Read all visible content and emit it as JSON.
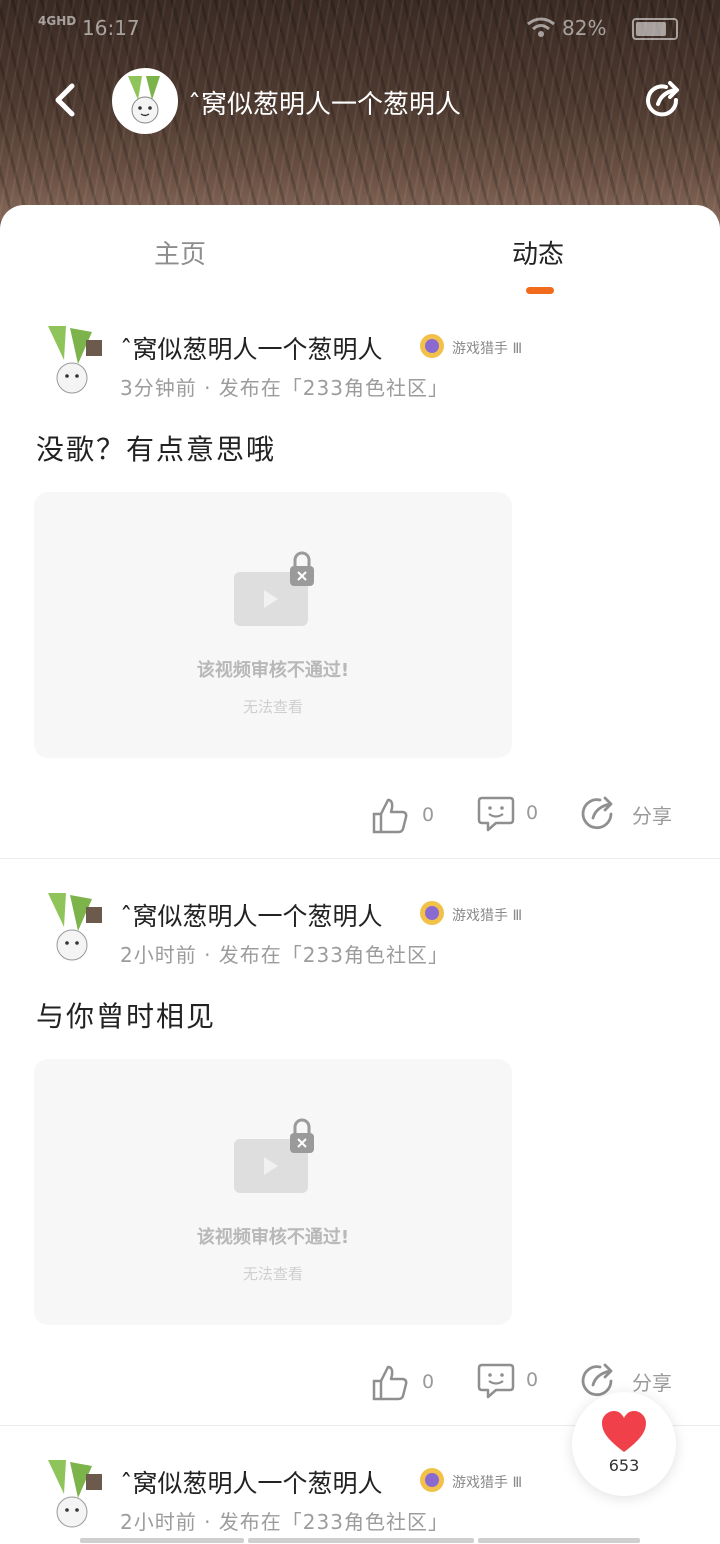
{
  "status_bar": {
    "network": "4GHD",
    "time": "16:17",
    "battery": "82%"
  },
  "header": {
    "username": "ˆ窝似葱明人一个葱明人"
  },
  "tabs": [
    {
      "label": "主页"
    },
    {
      "label": "动态"
    }
  ],
  "active_tab": "动态",
  "accent_color": "#f26b1d",
  "posts": [
    {
      "author": "ˆ窝似葱明人一个葱明人",
      "badge": "游戏猎手 Ⅲ",
      "meta": "3分钟前 · 发布在「233角色社区」",
      "text": "没歌？有点意思哦",
      "video_status": "该视频审核不通过!",
      "video_sub": "无法查看",
      "likes": "0",
      "comments": "0",
      "share_label": "分享"
    },
    {
      "author": "ˆ窝似葱明人一个葱明人",
      "badge": "游戏猎手 Ⅲ",
      "meta": "2小时前 · 发布在「233角色社区」",
      "text": "与你曾时相见",
      "video_status": "该视频审核不通过!",
      "video_sub": "无法查看",
      "likes": "0",
      "comments": "0",
      "share_label": "分享"
    },
    {
      "author": "ˆ窝似葱明人一个葱明人",
      "badge": "游戏猎手 Ⅲ",
      "meta": "2小时前 · 发布在「233角色社区」"
    }
  ],
  "floating_like": {
    "count": "653",
    "icon": "heart-icon"
  }
}
